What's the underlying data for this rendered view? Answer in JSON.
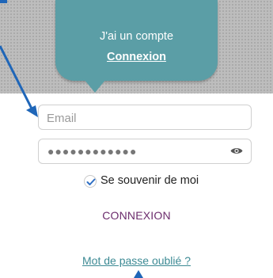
{
  "bubble": {
    "text": "J'ai un compte",
    "link_label": "Connexion"
  },
  "form": {
    "email_placeholder": "Email",
    "password_mask": "●●●●●●●●●●●●",
    "remember_label": "Se souvenir de moi",
    "remember_checked": true,
    "submit_label": "CONNEXION",
    "forgot_label": "Mot de passe oublié ?"
  },
  "icons": {
    "password_toggle": "eye-icon",
    "remember_check": "checkmark-icon"
  },
  "colors": {
    "bubble": "#5b9ea6",
    "accent_link": "#3c8a94",
    "submit_text": "#6b2b6c",
    "annotation_arrow": "#1f66b8"
  }
}
